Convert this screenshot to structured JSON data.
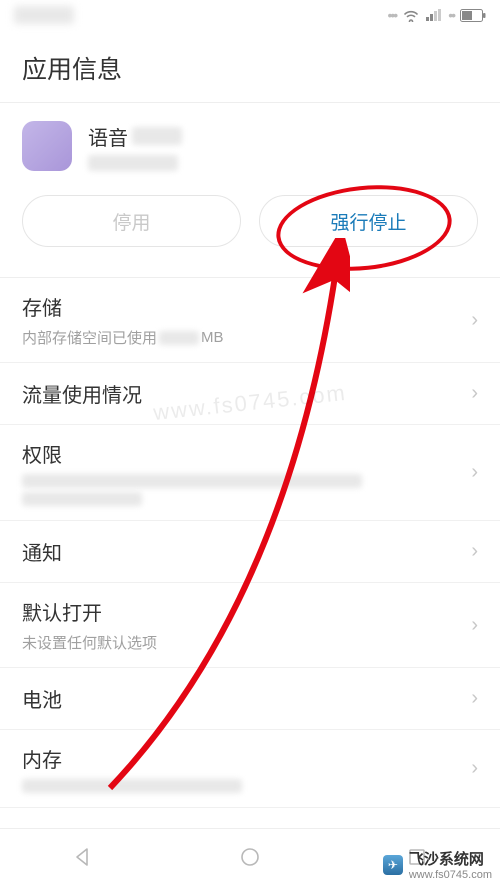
{
  "header": {
    "title": "应用信息"
  },
  "app": {
    "name": "语音"
  },
  "buttons": {
    "disable": "停用",
    "force_stop": "强行停止"
  },
  "storage": {
    "title": "存储",
    "sub_prefix": "内部存储空间已使用",
    "sub_unit": "MB"
  },
  "data_usage": {
    "title": "流量使用情况"
  },
  "permissions": {
    "title": "权限"
  },
  "notifications": {
    "title": "通知"
  },
  "default_open": {
    "title": "默认打开",
    "sub": "未设置任何默认选项"
  },
  "battery": {
    "title": "电池"
  },
  "memory": {
    "title": "内存"
  },
  "watermark": {
    "center": "www.fs0745.com",
    "brand": "飞沙系统网",
    "url": "www.fs0745.com"
  },
  "colors": {
    "accent": "#1a7bb9",
    "highlight": "#e30613"
  }
}
